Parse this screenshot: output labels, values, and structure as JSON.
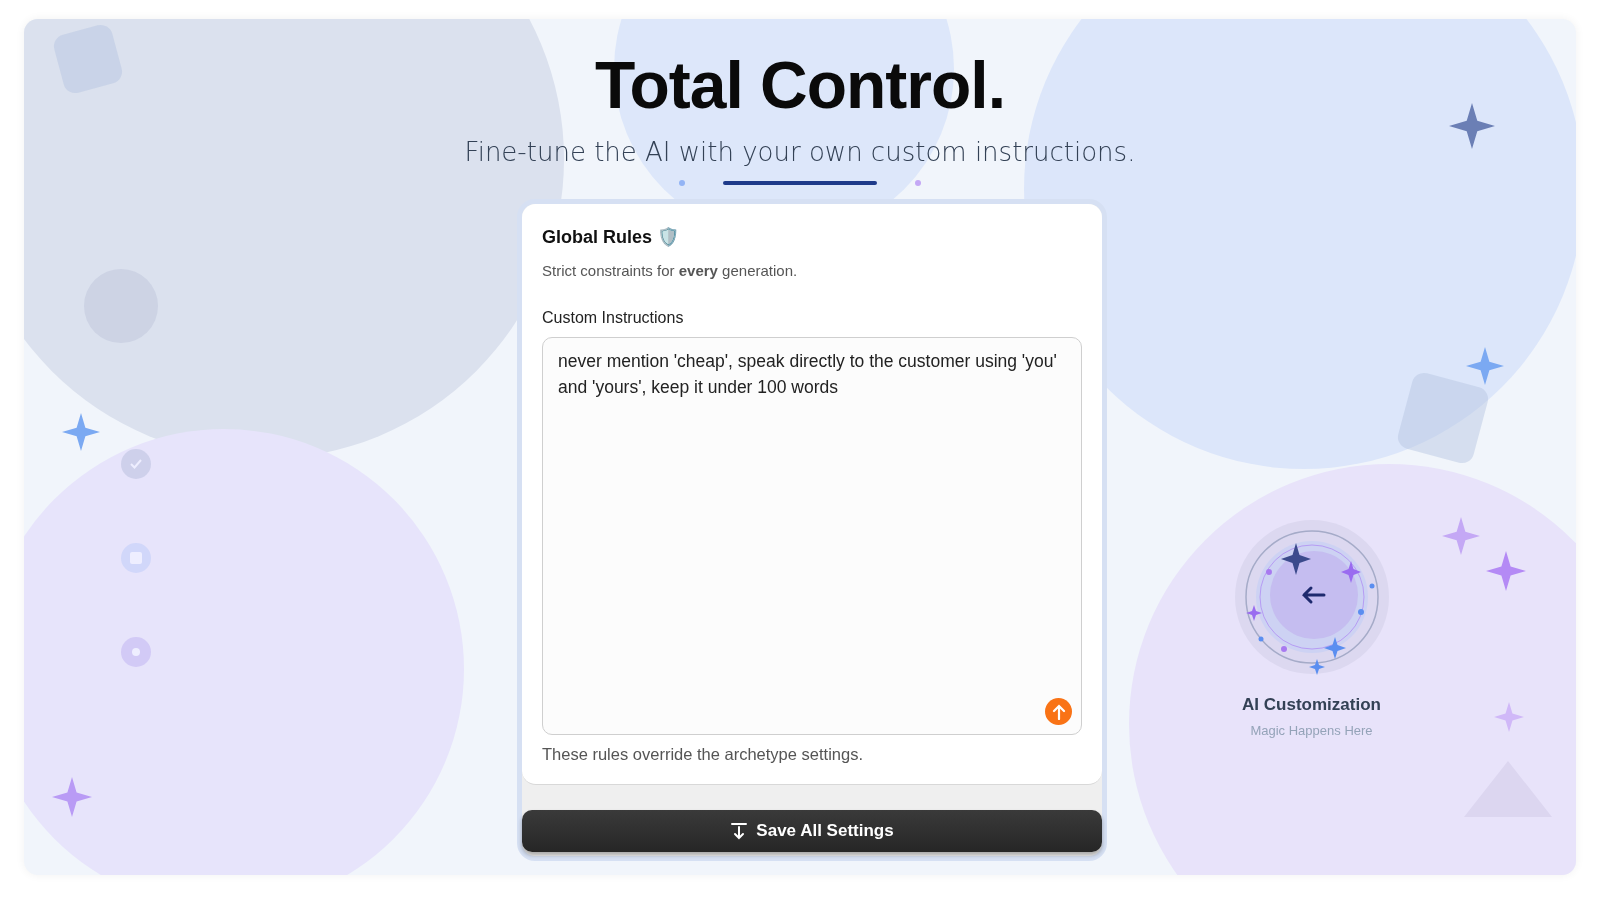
{
  "hero": {
    "title": "Total Control.",
    "subtitle": "Fine-tune the AI with your own custom instructions."
  },
  "steps": [
    {
      "selected": false,
      "color": "#93b4f5"
    },
    {
      "selected": true,
      "color": "#1e3a8a"
    },
    {
      "selected": false,
      "color": "#c4a8f5"
    }
  ],
  "card": {
    "title": "Global Rules 🛡️",
    "description": "Strict constraints for **every** generation.",
    "field_label": "Custom Instructions",
    "value": "never mention 'cheap', speak directly to the customer using 'you' and 'yours', keep it under 100 words",
    "hint": "These rules override the archetype settings."
  },
  "save_button": {
    "label": "Save All Settings"
  },
  "widget": {
    "title": "AI Customization",
    "subtitle": "Magic Happens Here"
  }
}
